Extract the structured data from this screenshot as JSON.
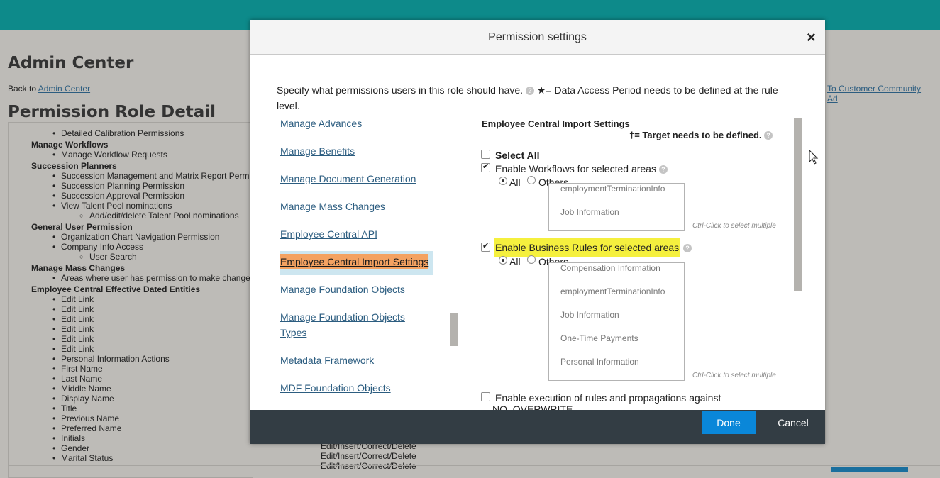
{
  "background": {
    "admin_center_title": "Admin Center",
    "back_prefix": "Back to",
    "back_link": "Admin Center",
    "page_title": "Permission Role Detail",
    "right_links": [
      "To Customer Community",
      "Ad"
    ],
    "list": [
      {
        "kind": "i",
        "text": "Detailed Calibration Permissions"
      },
      {
        "kind": "h",
        "text": "Manage Workflows"
      },
      {
        "kind": "i",
        "text": "Manage Workflow Requests"
      },
      {
        "kind": "h",
        "text": "Succession Planners"
      },
      {
        "kind": "i",
        "text": "Succession Management and Matrix Report Permissions"
      },
      {
        "kind": "i",
        "text": "Succession Planning Permission"
      },
      {
        "kind": "i",
        "text": "Succession Approval Permission"
      },
      {
        "kind": "i",
        "text": "View Talent Pool nominations"
      },
      {
        "kind": "ii",
        "text": "Add/edit/delete Talent Pool nominations"
      },
      {
        "kind": "h",
        "text": "General User Permission"
      },
      {
        "kind": "i",
        "text": "Organization Chart Navigation Permission"
      },
      {
        "kind": "i",
        "text": "Company Info Access"
      },
      {
        "kind": "ii",
        "text": "User Search"
      },
      {
        "kind": "h",
        "text": "Manage Mass Changes"
      },
      {
        "kind": "i",
        "text": "Areas where user has permission to make changes"
      },
      {
        "kind": "h",
        "text": "Employee Central Effective Dated Entities"
      },
      {
        "kind": "i",
        "text": "Edit Link"
      },
      {
        "kind": "i",
        "text": "Edit Link"
      },
      {
        "kind": "i",
        "text": "Edit Link"
      },
      {
        "kind": "i",
        "text": "Edit Link"
      },
      {
        "kind": "i",
        "text": "Edit Link"
      },
      {
        "kind": "i",
        "text": "Edit Link"
      },
      {
        "kind": "i",
        "text": "Personal Information Actions"
      },
      {
        "kind": "i",
        "text": "First Name"
      },
      {
        "kind": "i",
        "text": "Last Name"
      },
      {
        "kind": "i",
        "text": "Middle Name"
      },
      {
        "kind": "i",
        "text": "Display Name"
      },
      {
        "kind": "i",
        "text": "Title"
      },
      {
        "kind": "i",
        "text": "Previous Name"
      },
      {
        "kind": "i",
        "text": "Preferred Name"
      },
      {
        "kind": "i",
        "text": "Initials"
      },
      {
        "kind": "i",
        "text": "Gender"
      },
      {
        "kind": "i",
        "text": "Marital Status"
      }
    ],
    "edit_values": [
      "Edit/Insert/Correct/Delete",
      "Edit/Insert/Correct/Delete",
      "Edit/Insert/Correct/Delete"
    ]
  },
  "modal": {
    "title": "Permission settings",
    "close_glyph": "×",
    "intro_text": "Specify what permissions users in this role should have.",
    "intro_note": "★= Data Access Period needs to be defined at the rule level.",
    "nav_links": [
      "Manage Advances",
      "Manage Benefits",
      "Manage Document Generation",
      "Manage Mass Changes",
      "Employee Central API",
      "Employee Central Import Settings",
      "Manage Foundation Objects",
      "Manage Foundation Objects Types",
      "Metadata Framework",
      "MDF Foundation Objects"
    ],
    "active_nav": "Employee Central Import Settings",
    "section_title": "Employee Central Import Settings",
    "target_note": "†= Target needs to be defined.",
    "select_all": {
      "label": "Select All",
      "checked": false
    },
    "workflows": {
      "label": "Enable Workflows for selected areas",
      "checked": true,
      "radio_all": "All",
      "radio_others": "Others",
      "selected": "All",
      "options": [
        "employmentTerminationInfo",
        "Job Information"
      ],
      "hint": "Ctrl-Click to select multiple"
    },
    "business_rules": {
      "label": "Enable Business Rules for selected areas",
      "checked": true,
      "highlight_color": "#f5f03e",
      "radio_all": "All",
      "radio_others": "Others",
      "selected": "All",
      "options": [
        "Compensation Information",
        "employmentTerminationInfo",
        "Job Information",
        "One-Time Payments",
        "Personal Information"
      ],
      "hint": "Ctrl-Click to select multiple"
    },
    "no_overwrite": {
      "label": "Enable execution of rules and propagations against",
      "label2": "NO_OVERWRITE",
      "checked": false
    },
    "done_label": "Done",
    "cancel_label": "Cancel",
    "colors": {
      "header_teal": "#0d8a8a",
      "done_blue": "#0a87d9",
      "footer_dark": "#333d44",
      "active_orange": "#f4a261"
    }
  }
}
